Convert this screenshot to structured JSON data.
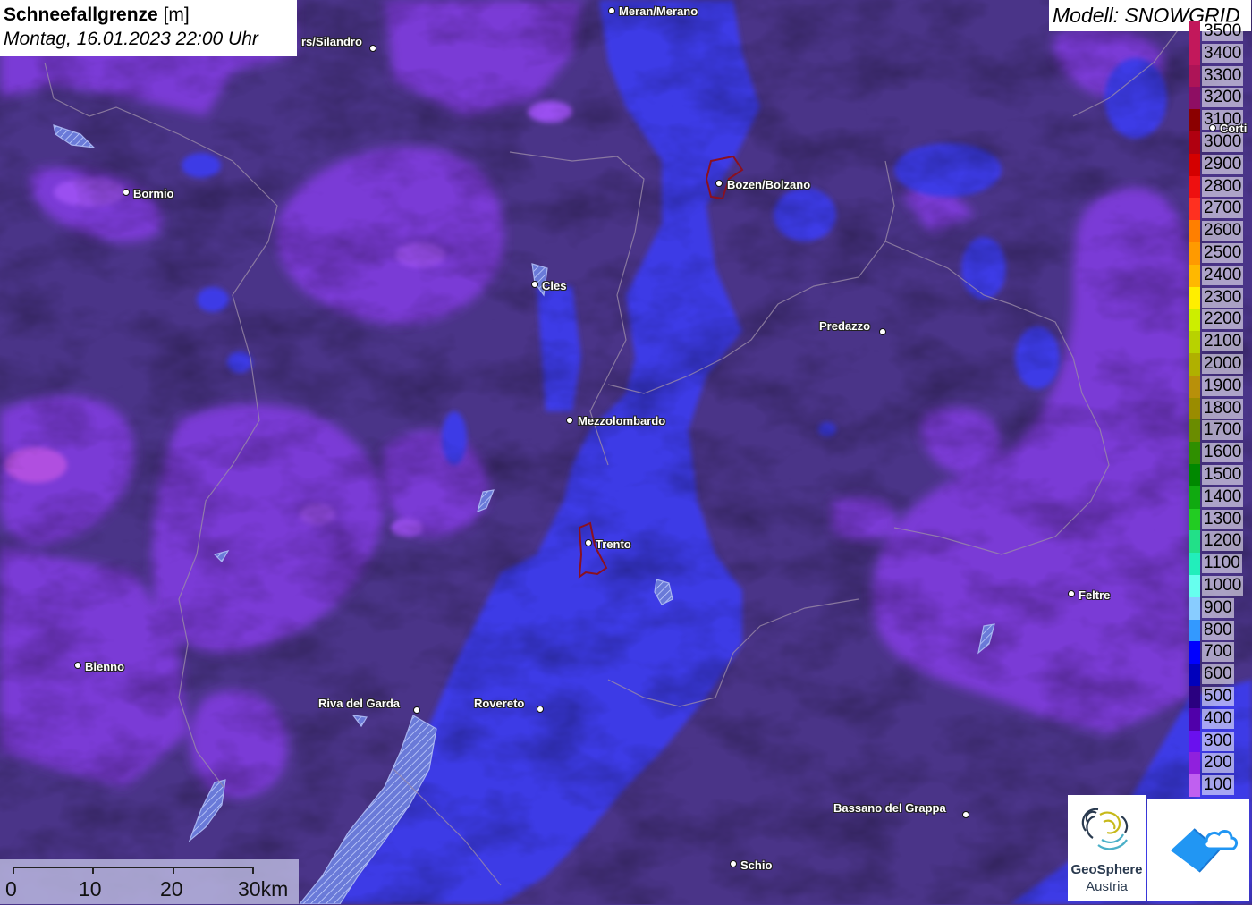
{
  "title": {
    "main": "Schneefallgrenze",
    "unit": "[m]",
    "datetime": "Montag, 16.01.2023 22:00 Uhr"
  },
  "model": {
    "label": "Modell: SNOWGRID"
  },
  "legend": [
    {
      "label": "3500",
      "color": "#c2185b"
    },
    {
      "label": "3400",
      "color": "#c2185b"
    },
    {
      "label": "3300",
      "color": "#ad1457"
    },
    {
      "label": "3200",
      "color": "#8e0e63"
    },
    {
      "label": "3100",
      "color": "#8b0000"
    },
    {
      "label": "3000",
      "color": "#b00010"
    },
    {
      "label": "2900",
      "color": "#d40000"
    },
    {
      "label": "2800",
      "color": "#ee1010"
    },
    {
      "label": "2700",
      "color": "#ff3020"
    },
    {
      "label": "2600",
      "color": "#ff7f00"
    },
    {
      "label": "2500",
      "color": "#ff9a00"
    },
    {
      "label": "2400",
      "color": "#ffb800"
    },
    {
      "label": "2300",
      "color": "#ffee00"
    },
    {
      "label": "2200",
      "color": "#ccee00"
    },
    {
      "label": "2100",
      "color": "#b8d200"
    },
    {
      "label": "2000",
      "color": "#b0b000"
    },
    {
      "label": "1900",
      "color": "#b8900a"
    },
    {
      "label": "1800",
      "color": "#9a8c00"
    },
    {
      "label": "1700",
      "color": "#6a8c00"
    },
    {
      "label": "1600",
      "color": "#2f8f00"
    },
    {
      "label": "1500",
      "color": "#008800"
    },
    {
      "label": "1400",
      "color": "#10aa10"
    },
    {
      "label": "1300",
      "color": "#22cc22"
    },
    {
      "label": "1200",
      "color": "#22e088"
    },
    {
      "label": "1100",
      "color": "#22eebb"
    },
    {
      "label": "1000",
      "color": "#66ffee"
    },
    {
      "label": "900",
      "color": "#88ccff"
    },
    {
      "label": "800",
      "color": "#3399ff"
    },
    {
      "label": "700",
      "color": "#0000ff"
    },
    {
      "label": "600",
      "color": "#0000bb"
    },
    {
      "label": "500",
      "color": "#2a0080"
    },
    {
      "label": "400",
      "color": "#5000aa"
    },
    {
      "label": "300",
      "color": "#6a10ee"
    },
    {
      "label": "200",
      "color": "#9020dd"
    },
    {
      "label": "100",
      "color": "#c060f0"
    }
  ],
  "cities": [
    {
      "name": "Meran/Merano"
    },
    {
      "name": "rs/Silandro"
    },
    {
      "name": "Bormio"
    },
    {
      "name": "Bozen/Bolzano"
    },
    {
      "name": "Corti"
    },
    {
      "name": "Cles"
    },
    {
      "name": "Predazzo"
    },
    {
      "name": "Mezzolombardo"
    },
    {
      "name": "Trento"
    },
    {
      "name": "Feltre"
    },
    {
      "name": "Bienno"
    },
    {
      "name": "Riva del Garda"
    },
    {
      "name": "Rovereto"
    },
    {
      "name": "Bassano del Grappa"
    },
    {
      "name": "Schio"
    }
  ],
  "scale": {
    "labels": [
      "0",
      "10",
      "20",
      "30km"
    ]
  },
  "logos": {
    "geosphere_line1": "GeoSphere",
    "geosphere_line2": "Austria"
  }
}
